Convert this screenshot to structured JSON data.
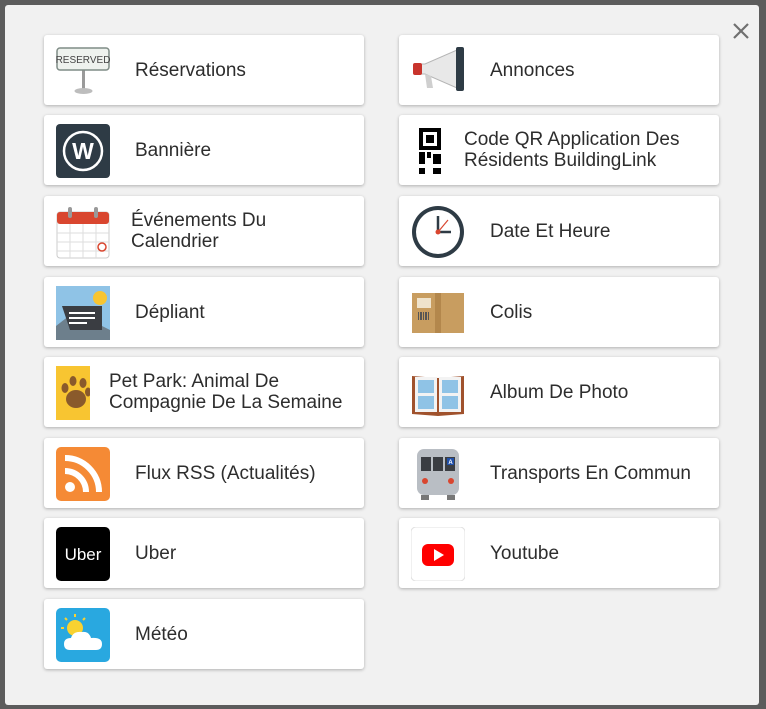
{
  "dialog": {
    "close_label": "close",
    "widgets": [
      {
        "id": "reservations",
        "label": "Réservations",
        "icon": "reserved-sign-icon",
        "reserved_text": "RESERVED"
      },
      {
        "id": "announcements",
        "label": "Annonces",
        "icon": "megaphone-icon"
      },
      {
        "id": "banner",
        "label": "Bannière",
        "icon": "banner-w-icon",
        "logo_letter": "W"
      },
      {
        "id": "qr",
        "label": "Code QR Application Des Résidents BuildingLink",
        "icon": "qr-code-icon"
      },
      {
        "id": "calendar",
        "label": "Événements Du Calendrier",
        "icon": "calendar-icon"
      },
      {
        "id": "datetime",
        "label": "Date Et Heure",
        "icon": "clock-icon"
      },
      {
        "id": "flyer",
        "label": "Dépliant",
        "icon": "flyer-icon"
      },
      {
        "id": "packages",
        "label": "Colis",
        "icon": "package-icon"
      },
      {
        "id": "petpark",
        "label": "Pet Park: Animal De Compagnie De La Semaine",
        "icon": "paw-icon"
      },
      {
        "id": "album",
        "label": "Album De Photo",
        "icon": "photo-album-icon"
      },
      {
        "id": "rss",
        "label": "Flux RSS (Actualités)",
        "icon": "rss-icon"
      },
      {
        "id": "transit",
        "label": "Transports En Commun",
        "icon": "subway-train-icon",
        "train_letter": "A"
      },
      {
        "id": "uber",
        "label": "Uber",
        "icon": "uber-logo-icon",
        "logo_text": "Uber"
      },
      {
        "id": "youtube",
        "label": "Youtube",
        "icon": "youtube-icon"
      },
      {
        "id": "weather",
        "label": "Météo",
        "icon": "weather-icon"
      }
    ]
  },
  "colors": {
    "overlay": "#5c5c5c",
    "modal_bg": "#f1f1f1",
    "card_bg": "#ffffff",
    "text": "#2d2d2d",
    "rss_orange": "#f58a35",
    "uber_black": "#000000",
    "youtube_red": "#ff0000",
    "weather_blue": "#29a8e0",
    "calendar_red": "#d9462f",
    "banner_dark": "#2e3b45"
  }
}
